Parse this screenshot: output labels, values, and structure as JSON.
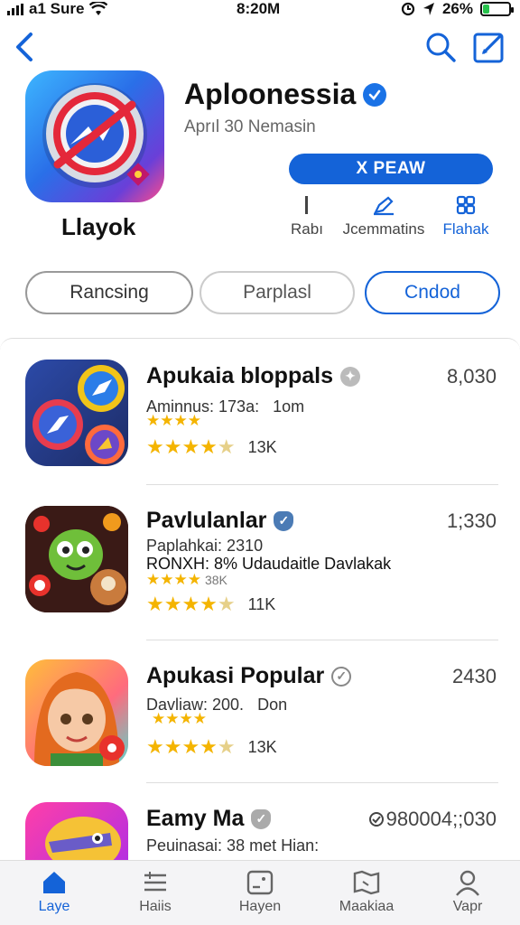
{
  "status_bar": {
    "carrier": "a1 Sure",
    "time": "8:20M",
    "battery": "26%",
    "battery_level": 0.26
  },
  "app": {
    "title": "Aploonessia",
    "subtitle": "Aprıl 30 Nemasin",
    "name_under_icon": "Llayok",
    "get_button": "X PEAW",
    "actions": [
      "Rabı",
      "Jcemmatins",
      "Flahak"
    ]
  },
  "pills": {
    "left": "Rancsing",
    "middle": "Parplasl",
    "right": "Cndod"
  },
  "list": {
    "items": [
      {
        "title": "Apukaia bloppals",
        "price": "8,030",
        "meta": "Aminnus: 173a:",
        "meta_extra": "1om",
        "rating_count": "13K",
        "stars": 4.5
      },
      {
        "title": "Pavlulanlar",
        "price": "1;330",
        "meta": "Paplahkai: 2310",
        "meta_line2": "RONXH: 8% Udaudaitle Davlakak",
        "small_stars_text": "38K",
        "rating_count": "11K",
        "stars": 4.5
      },
      {
        "title": "Apukasi Popular",
        "price": "2430",
        "meta": "Davliaw: 200.",
        "meta_extra": "Don",
        "rating_count": "13K",
        "stars": 4.5
      },
      {
        "title": "Eamy Ma",
        "price": "980004;;030",
        "meta": "Peuinasai: 38 met Hian:"
      }
    ]
  },
  "tabs": [
    "Laye",
    "Haiis",
    "Hayen",
    "Maakiaa",
    "Vapr"
  ],
  "colors": {
    "accent": "#1463d8",
    "star": "#f4b400",
    "battery": "#27c24c"
  }
}
